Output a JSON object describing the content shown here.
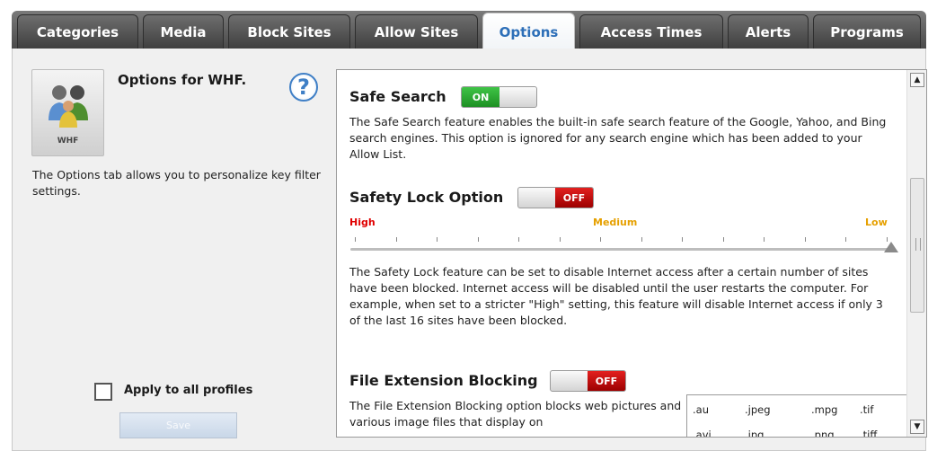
{
  "tabs": [
    {
      "label": "Categories"
    },
    {
      "label": "Media"
    },
    {
      "label": "Block Sites"
    },
    {
      "label": "Allow Sites"
    },
    {
      "label": "Options"
    },
    {
      "label": "Access Times"
    },
    {
      "label": "Alerts"
    },
    {
      "label": "Programs"
    }
  ],
  "profile": {
    "name": "WHF",
    "title": "Options for WHF.",
    "description": "The Options tab allows you to personalize key filter settings.",
    "help_glyph": "?"
  },
  "footer": {
    "apply_label": "Apply to all profiles",
    "save_label": "Save"
  },
  "scrollbar": {
    "up": "▲",
    "down": "▼"
  },
  "safe_search": {
    "title": "Safe Search",
    "state": "ON",
    "text": "The Safe Search feature enables the built-in safe search feature of the Google, Yahoo, and Bing search engines.  This option is ignored for any search engine which has been added to your Allow List."
  },
  "safety_lock": {
    "title": "Safety Lock Option",
    "state": "OFF",
    "levels": {
      "high": "High",
      "medium": "Medium",
      "low": "Low"
    },
    "level_value": 1.0,
    "text": "The Safety Lock feature can be set to disable Internet access after a certain number of sites have been blocked.  Internet access will be disabled until the user restarts the computer.  For example, when set to a stricter \"High\" setting, this feature will disable Internet access if only 3 of the last 16 sites have been blocked."
  },
  "file_ext": {
    "title": "File Extension Blocking",
    "state": "OFF",
    "text": "The File Extension Blocking option blocks web pictures and various image files that display on",
    "extensions_row1": [
      ".au",
      ".jpeg",
      ".mpg",
      ".tif"
    ],
    "extensions_row2": [
      ".avi",
      ".jpg",
      ".png",
      ".tiff"
    ]
  },
  "colors": {
    "accent": "#2d6fb8",
    "on": "#2aa830",
    "off": "#c40000",
    "high": "#e00000",
    "medium": "#e6a000",
    "low": "#e6a000"
  }
}
